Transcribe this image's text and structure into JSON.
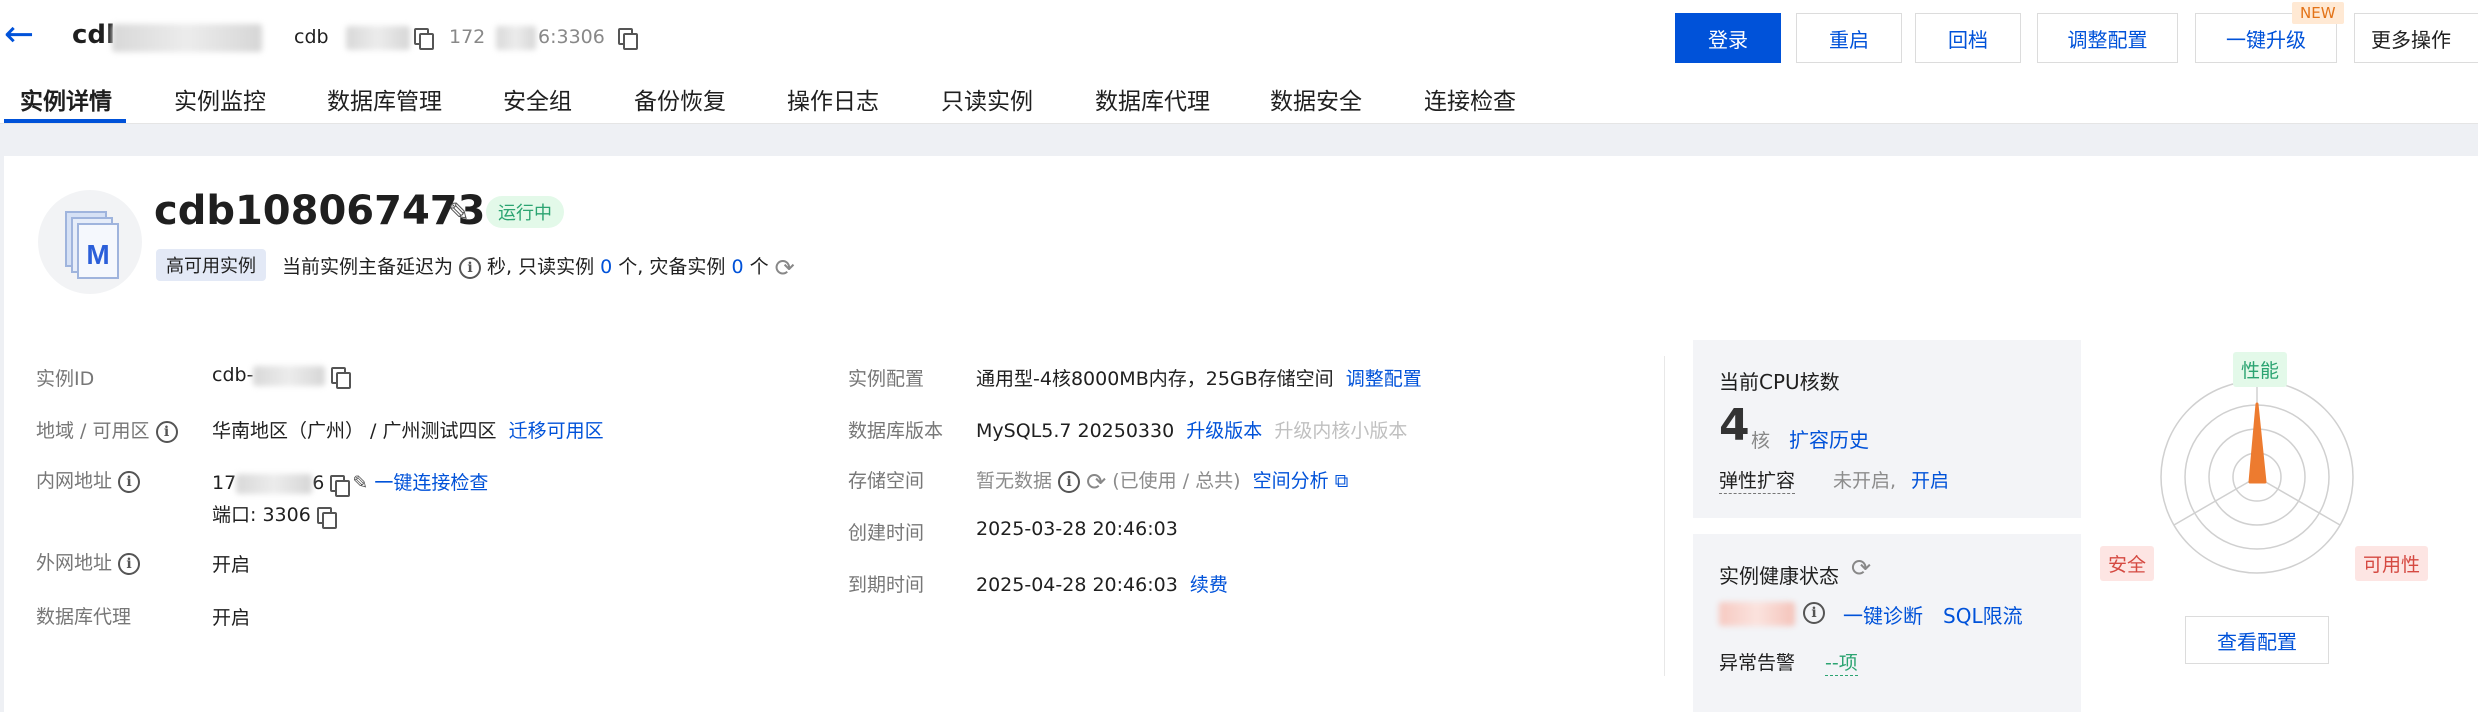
{
  "header": {
    "title_prefix": "cdl",
    "sub_prefix": "cdb",
    "ip_prefix": "172",
    "ip_suffix": "6:3306",
    "buttons": {
      "login": "登录",
      "restart": "重启",
      "rollback": "回档",
      "adjust": "调整配置",
      "upgrade": "一键升级",
      "new_badge": "NEW",
      "more": "更多操作"
    }
  },
  "tabs": [
    "实例详情",
    "实例监控",
    "数据库管理",
    "安全组",
    "备份恢复",
    "操作日志",
    "只读实例",
    "数据库代理",
    "数据安全",
    "连接检查"
  ],
  "instance": {
    "name": "cdb108067473",
    "status": "运行中",
    "type_badge": "高可用实例",
    "delay_text1": "当前实例主备延迟为",
    "delay_text2": "秒, 只读实例",
    "readonly_count": "0",
    "delay_text3": "个, 灾备实例",
    "dr_count": "0",
    "delay_text4": "个"
  },
  "details_left": {
    "id_label": "实例ID",
    "id_prefix": "cdb-",
    "region_label": "地域 / 可用区",
    "region_value": "华南地区（广州） / 广州测试四区",
    "region_link": "迁移可用区",
    "intranet_label": "内网地址",
    "intranet_prefix": "17",
    "intranet_suffix": "6",
    "intranet_link": "一键连接检查",
    "port_text": "端口: 3306",
    "extranet_label": "外网地址",
    "extranet_link": "开启",
    "proxy_label": "数据库代理",
    "proxy_link": "开启"
  },
  "details_mid": {
    "config_label": "实例配置",
    "config_value": "通用型-4核8000MB内存，25GB存储空间",
    "config_link": "调整配置",
    "version_label": "数据库版本",
    "version_value": "MySQL5.7 20250330",
    "version_link": "升级版本",
    "version_link2": "升级内核小版本",
    "storage_label": "存储空间",
    "storage_value": "暂无数据",
    "storage_used": "(已使用 / 总共)",
    "storage_link": "空间分析",
    "created_label": "创建时间",
    "created_value": "2025-03-28 20:46:03",
    "expire_label": "到期时间",
    "expire_value": "2025-04-28 20:46:03",
    "expire_link": "续费"
  },
  "cpu": {
    "title": "当前CPU核数",
    "count": "4",
    "unit": "核",
    "history_link": "扩容历史",
    "elastic_label": "弹性扩容",
    "elastic_status": "未开启,",
    "elastic_link": "开启"
  },
  "health": {
    "title": "实例健康状态",
    "diagnose_link": "一键诊断",
    "sql_link": "SQL限流",
    "alarm_label": "异常告警",
    "alarm_value": "--项"
  },
  "radar": {
    "performance": "性能",
    "security": "安全",
    "availability": "可用性",
    "view_config": "查看配置",
    "colors": {
      "performance_bg": "#e3f9e9",
      "performance_fg": "#2ba471",
      "warn_bg": "#fde5e3",
      "warn_fg": "#d54941",
      "shape": "#ed7b2f"
    }
  }
}
